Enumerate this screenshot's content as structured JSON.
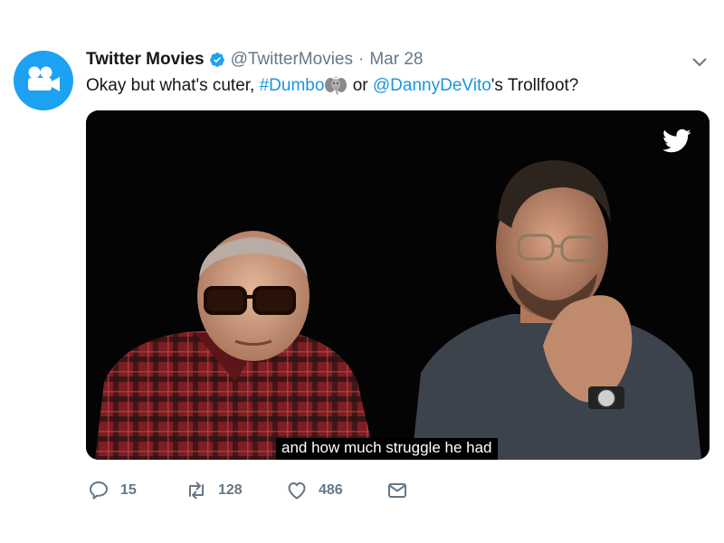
{
  "tweet": {
    "display_name": "Twitter Movies",
    "handle": "@TwitterMovies",
    "separator": "·",
    "date": "Mar 28",
    "text_before": "Okay but what's cuter, ",
    "hashtag": "#Dumbo",
    "text_middle": " or ",
    "mention": "@DannyDeVito",
    "text_after": "'s Trollfoot?",
    "emoji_name": "dumbo-elephant-emoji"
  },
  "media": {
    "caption": "and how much struggle he had",
    "watermark_icon": "twitter-bird-icon"
  },
  "actions": {
    "reply_count": "15",
    "retweet_count": "128",
    "like_count": "486"
  },
  "colors": {
    "accent": "#1da1f2",
    "link": "#1b95e0",
    "muted": "#657786",
    "text": "#14171a"
  }
}
